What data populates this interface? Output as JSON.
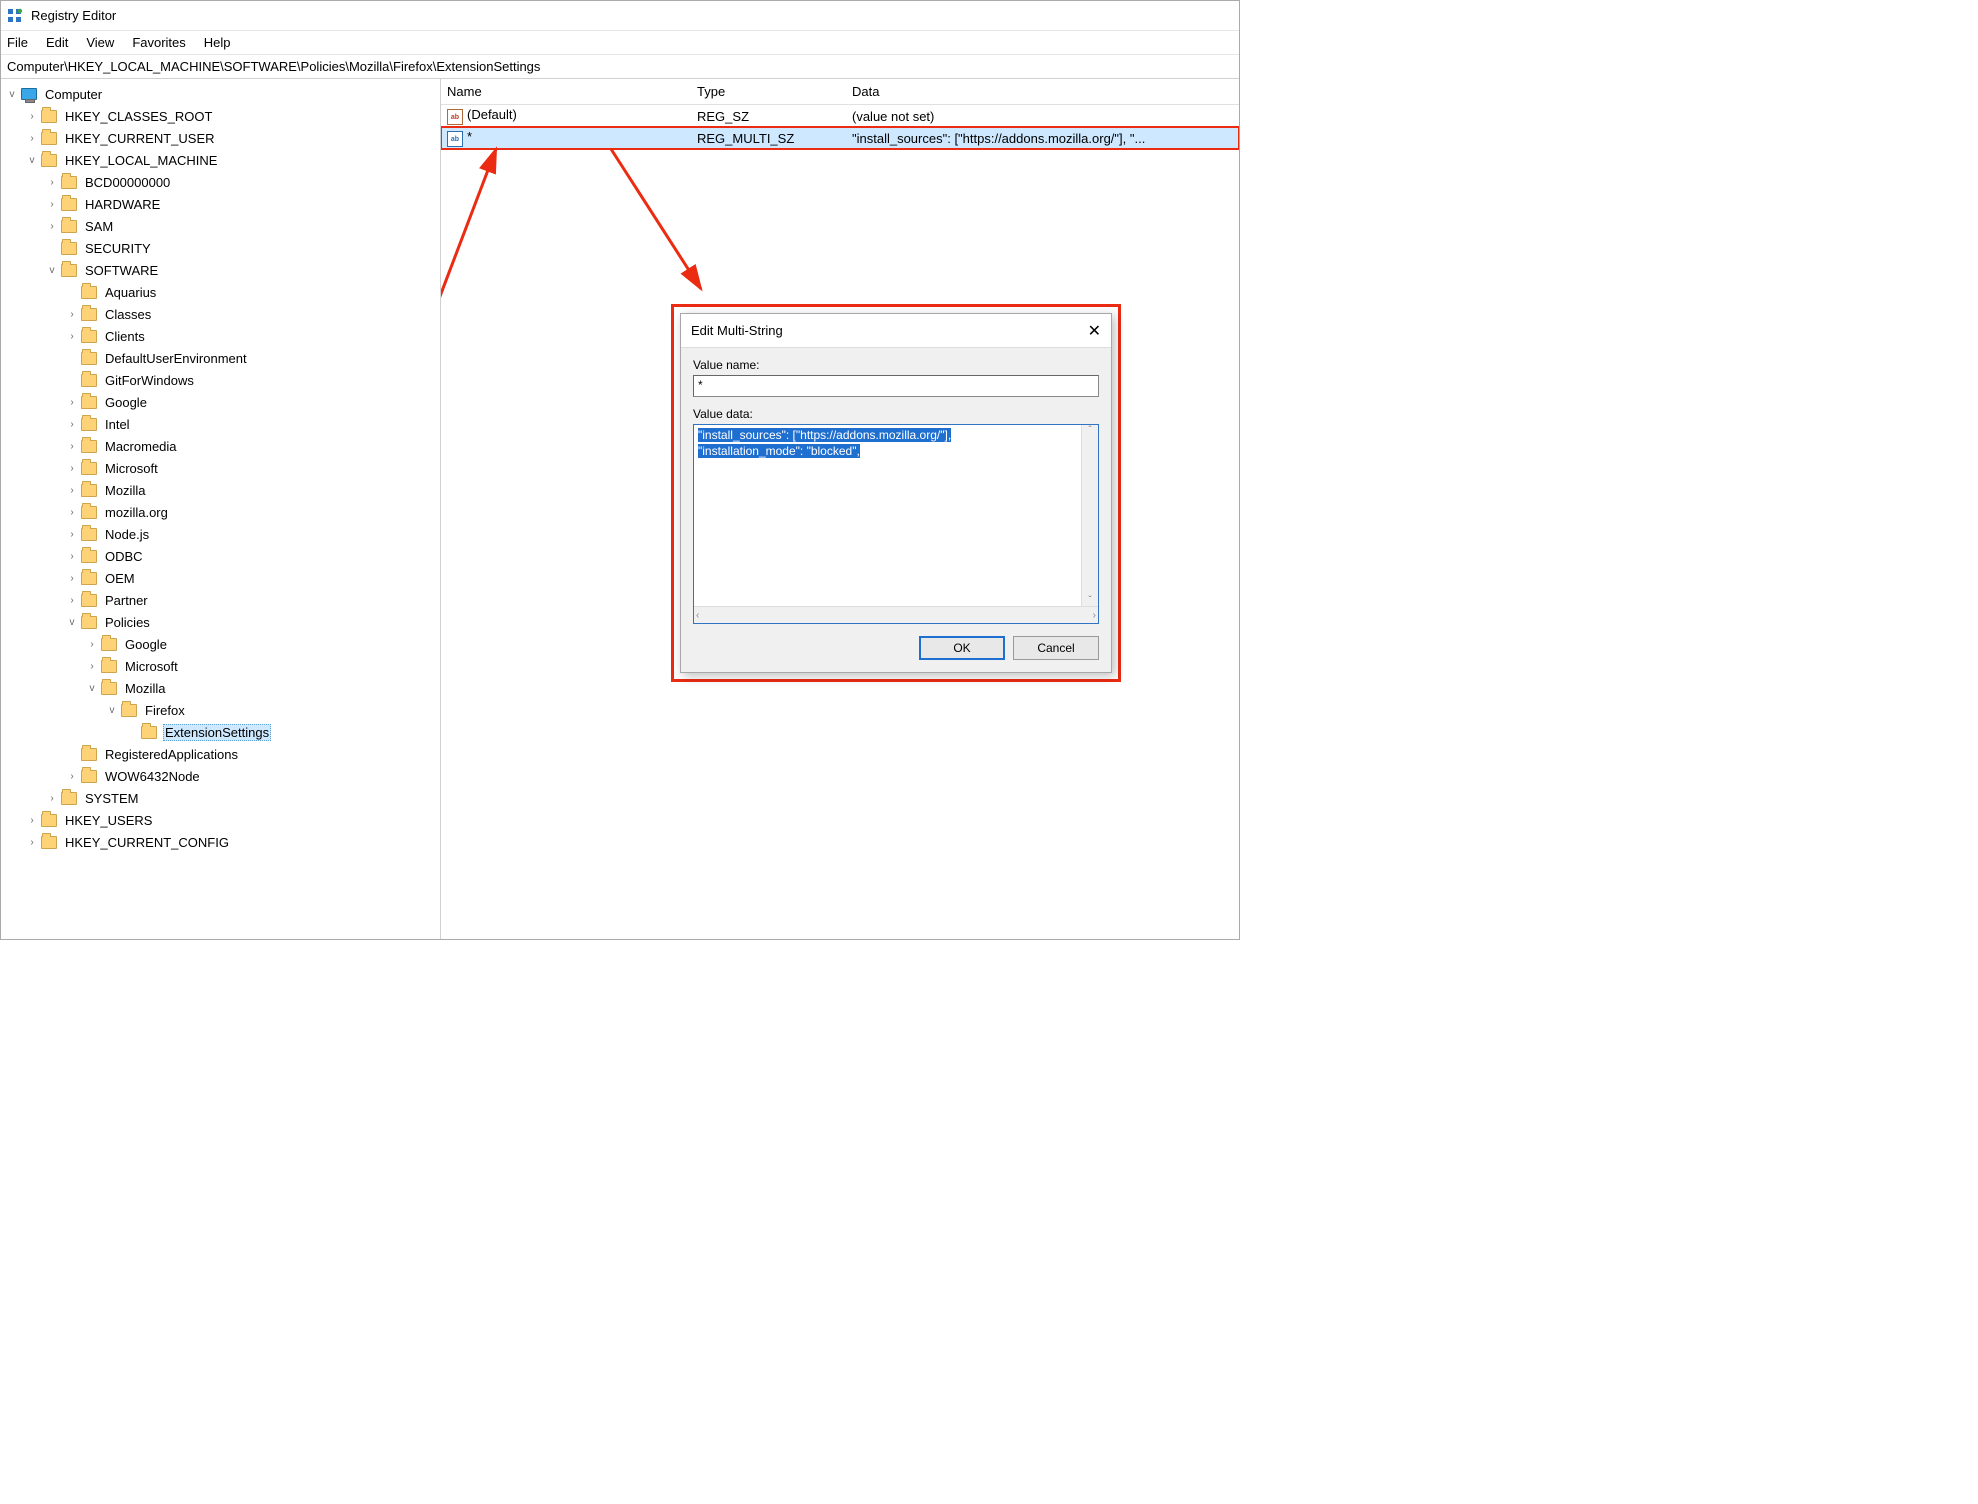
{
  "app": {
    "title": "Registry Editor"
  },
  "menu": {
    "file": "File",
    "edit": "Edit",
    "view": "View",
    "fav": "Favorites",
    "help": "Help"
  },
  "address": "Computer\\HKEY_LOCAL_MACHINE\\SOFTWARE\\Policies\\Mozilla\\Firefox\\ExtensionSettings",
  "tree": {
    "root": "Computer",
    "hkcr": "HKEY_CLASSES_ROOT",
    "hkcu": "HKEY_CURRENT_USER",
    "hklm": "HKEY_LOCAL_MACHINE",
    "bcd": "BCD00000000",
    "hw": "HARDWARE",
    "sam": "SAM",
    "sec": "SECURITY",
    "sw": "SOFTWARE",
    "sw_items": {
      "aquarius": "Aquarius",
      "classes": "Classes",
      "clients": "Clients",
      "due": "DefaultUserEnvironment",
      "gfw": "GitForWindows",
      "google": "Google",
      "intel": "Intel",
      "macro": "Macromedia",
      "ms": "Microsoft",
      "moz": "Mozilla",
      "mozorg": "mozilla.org",
      "node": "Node.js",
      "odbc": "ODBC",
      "oem": "OEM",
      "partner": "Partner",
      "policies": "Policies",
      "regapps": "RegisteredApplications",
      "wow": "WOW6432Node"
    },
    "pol": {
      "google": "Google",
      "ms": "Microsoft",
      "moz": "Mozilla",
      "ff": "Firefox",
      "ext": "ExtensionSettings"
    },
    "system": "SYSTEM",
    "hku": "HKEY_USERS",
    "hkcc": "HKEY_CURRENT_CONFIG"
  },
  "values": {
    "cols": {
      "name": "Name",
      "type": "Type",
      "data": "Data"
    },
    "rows": [
      {
        "icon": "sz",
        "name": "(Default)",
        "type": "REG_SZ",
        "data": "(value not set)"
      },
      {
        "icon": "multi",
        "name": "*",
        "type": "REG_MULTI_SZ",
        "data": "\"install_sources\": [\"https://addons.mozilla.org/\"], \"..."
      }
    ]
  },
  "dialog": {
    "title": "Edit Multi-String",
    "lbl_name": "Value name:",
    "name": "*",
    "lbl_data": "Value data:",
    "line1": "\"install_sources\": [\"https://addons.mozilla.org/\"],",
    "line2": "\"installation_mode\": \"blocked\",",
    "ok": "OK",
    "cancel": "Cancel"
  }
}
